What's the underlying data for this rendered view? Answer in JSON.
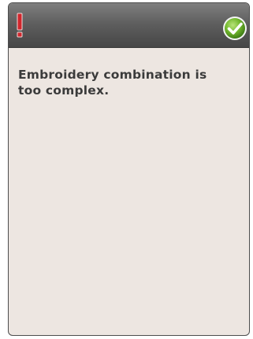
{
  "dialog": {
    "message": "Embroidery combination is too complex.",
    "title_icon": "exclamation-icon",
    "confirm_icon": "checkmark-icon",
    "colors": {
      "title_bar": "#5f5f5f",
      "body": "#ede6e1",
      "warning": "#c8262c",
      "confirm": "#6fb52c",
      "text": "#3b3b3b"
    }
  }
}
